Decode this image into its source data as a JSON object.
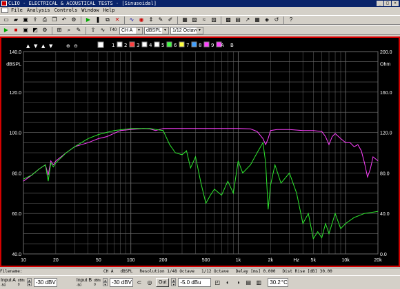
{
  "window": {
    "title": "CLIO - ELECTRICAL & ACOUSTICAL TESTS - [Sinusoidal]",
    "controls": [
      "_",
      "□",
      "×"
    ]
  },
  "menu": [
    "File",
    "Analysis",
    "Controls",
    "Window",
    "Help"
  ],
  "toolbar1": {
    "icons": [
      "new-icon",
      "open-icon",
      "save-icon",
      "export-icon",
      "print-icon",
      "copy-icon",
      "undo-icon",
      "settings-icon",
      "sep",
      "go-icon",
      "pause-icon",
      "copy2-icon",
      "delete-icon",
      "sep",
      "signal-icon",
      "mic-icon",
      "scale-icon",
      "tool-icon",
      "tool2-icon",
      "sep",
      "fft-icon",
      "mls-icon",
      "sine-icon",
      "wf-icon",
      "sep",
      "mlsb-icon",
      "rta-icon",
      "sweep-icon",
      "grid-icon",
      "cal-icon",
      "reset-icon",
      "sep",
      "help-icon"
    ]
  },
  "toolbar2": {
    "buttons": [
      "go-icon",
      "stop-icon",
      "capture-icon",
      "auto-icon",
      "settings-icon",
      "sep",
      "zoom-icon",
      "magnify-icon",
      "marker-icon",
      "sep",
      "load-icon",
      "smooth-icon",
      "T40"
    ],
    "channel": "CH A",
    "units": "dBSPL",
    "smoothing": "1/12 Octave"
  },
  "graph": {
    "overlay_buttons": [
      "▲",
      "▼",
      "▲",
      "▼",
      "sep",
      "⊕",
      "⊖"
    ],
    "overlay_numbers": [
      "1",
      "2",
      "3",
      "4",
      "5",
      "6",
      "7",
      "8",
      "9",
      "A",
      "B"
    ],
    "y_left_unit": "dBSPL",
    "y_right_unit": "Ohm",
    "y_left_ticks": [
      "140.0",
      "120.0",
      "100.0",
      "80.0",
      "60.0",
      "40.0"
    ],
    "y_right_ticks": [
      "200.0",
      "160.0",
      "120.0",
      "80.0",
      "40.0",
      "0.0"
    ],
    "x_ticks": [
      "10",
      "20",
      "50",
      "100",
      "200",
      "500",
      "1k",
      "2k",
      "5k",
      "10k",
      "20k"
    ],
    "x_unit": "Hz",
    "colors": {
      "frame": "#d40000",
      "grid": "#6a6a6a",
      "spl_trace": "#ff40ff",
      "impedance_trace": "#2ee82e",
      "axis_text": "#ffffff"
    }
  },
  "chart_data": {
    "type": "line",
    "xlabel": "Hz",
    "ylabel": "dBSPL",
    "y2label": "Ohm",
    "xscale": "log",
    "xlim": [
      10,
      20000
    ],
    "ylim": [
      40,
      140
    ],
    "y2lim": [
      0,
      200
    ],
    "grid": true,
    "series": [
      {
        "axis": "left",
        "color": "#ff40ff",
        "x": [
          10,
          12,
          14,
          16,
          17,
          18,
          19,
          20,
          25,
          30,
          40,
          50,
          60,
          80,
          100,
          130,
          150,
          170,
          200,
          300,
          500,
          700,
          1000,
          1300,
          1500,
          1700,
          1800,
          1900,
          2000,
          2300,
          3000,
          4000,
          5000,
          6000,
          6500,
          7000,
          7500,
          8000,
          9000,
          10000,
          11000,
          12000,
          13000,
          14000,
          15000,
          16000,
          17000,
          18000,
          20000
        ],
        "values": [
          76,
          79,
          82,
          84,
          79,
          86,
          84,
          86,
          90,
          93,
          95,
          97,
          98,
          101,
          101.5,
          102,
          101.8,
          101,
          102,
          102,
          102,
          102,
          102,
          101.8,
          100.5,
          97,
          94,
          97,
          101,
          101.5,
          101.5,
          101,
          101,
          100.5,
          98,
          94,
          98,
          99.5,
          97,
          95,
          95,
          93,
          94,
          91,
          85,
          78,
          82,
          88,
          86
        ]
      },
      {
        "axis": "right",
        "color": "#2ee82e",
        "x": [
          10,
          12,
          14,
          16,
          17,
          18,
          19,
          20,
          25,
          30,
          40,
          50,
          70,
          100,
          150,
          200,
          230,
          260,
          300,
          330,
          360,
          400,
          450,
          500,
          550,
          600,
          700,
          800,
          900,
          1000,
          1100,
          1300,
          1500,
          1700,
          1800,
          1900,
          2000,
          2200,
          2500,
          3000,
          3500,
          4000,
          4500,
          5000,
          5500,
          6000,
          6500,
          7000,
          8000,
          9000,
          10000,
          12000,
          15000,
          20000
        ],
        "values": [
          74,
          78,
          84,
          88,
          72,
          90,
          86,
          90,
          100,
          106,
          114,
          118,
          122,
          124,
          124,
          122,
          108,
          100,
          98,
          102,
          85,
          96,
          70,
          50,
          58,
          64,
          58,
          72,
          60,
          92,
          80,
          88,
          100,
          110,
          90,
          44,
          68,
          88,
          70,
          80,
          60,
          30,
          40,
          15,
          22,
          16,
          30,
          20,
          40,
          25,
          30,
          36,
          40,
          42
        ]
      }
    ]
  },
  "status": {
    "filename_label": "Filename:",
    "channel": "CH A",
    "units": "dBSPL",
    "resolution": "Resolution 1/48 Octave",
    "smoothing": "1/12 Octave",
    "delay": "Delay [ms] 0.000",
    "dist_rise": "Dist Rise [dB] 30.00"
  },
  "bottom": {
    "input_a_label": "Input A",
    "input_a_sub": "-50",
    "input_b_label": "Input B",
    "input_b_sub": "-50",
    "dbfs_label": "dBfs",
    "dbfs_sub": "0",
    "input_a_value": "-30 dBV",
    "input_b_value": "-30 dBV",
    "out_label": "Out",
    "out_value": "-5.0 dBu",
    "temp": "30.2",
    "temp_unit": "°C"
  }
}
